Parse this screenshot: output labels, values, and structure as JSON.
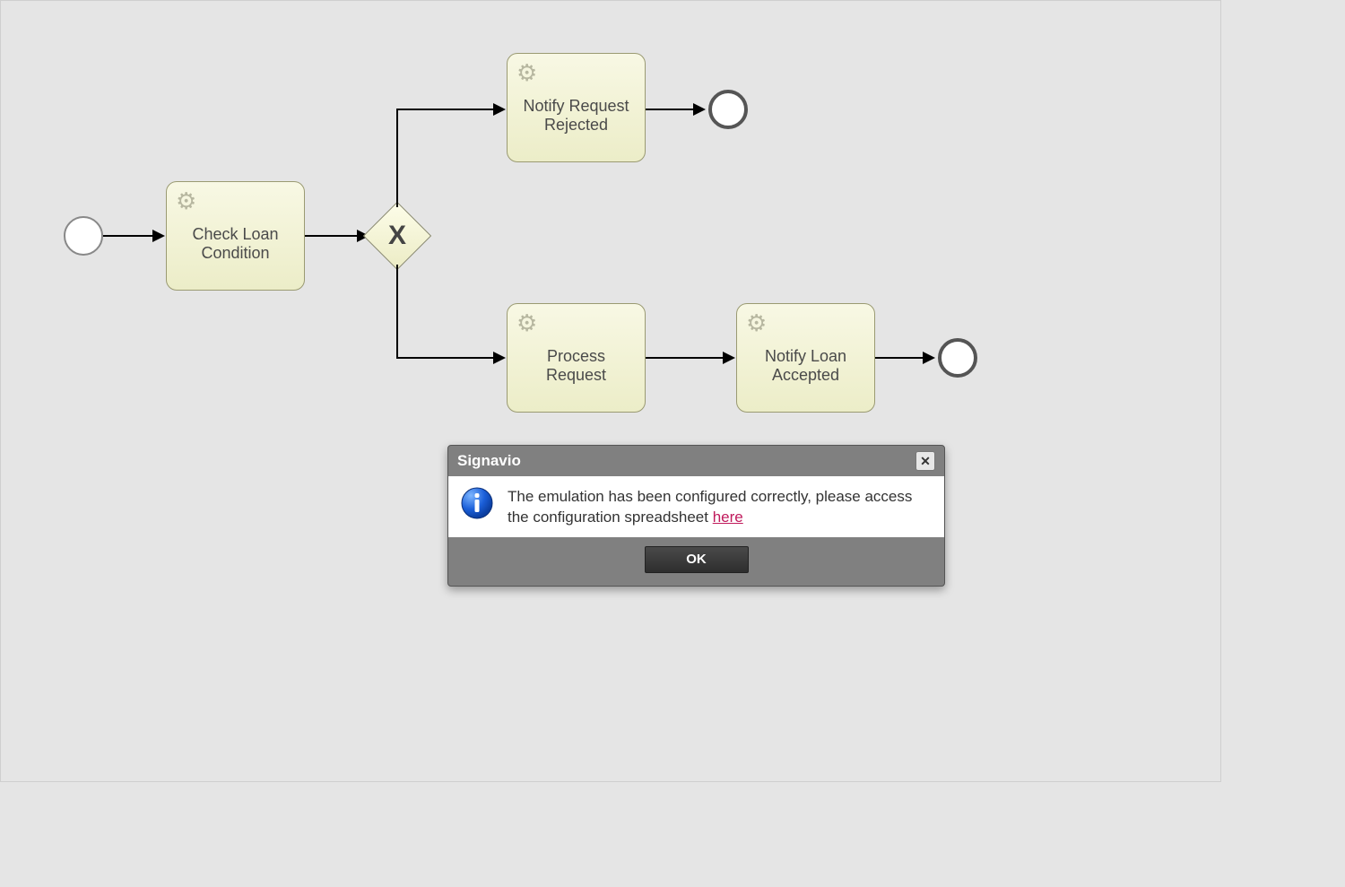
{
  "diagram": {
    "tasks": {
      "check_loan": {
        "label": "Check Loan\nCondition"
      },
      "notify_reject": {
        "label": "Notify Request\nRejected"
      },
      "process_req": {
        "label": "Process\nRequest"
      },
      "notify_accept": {
        "label": "Notify Loan\nAccepted"
      }
    },
    "gateway_symbol": "X"
  },
  "dialog": {
    "title": "Signavio",
    "message": "The emulation has been configured correctly, please access the configuration spreadsheet ",
    "link_text": "here",
    "ok_label": "OK"
  }
}
